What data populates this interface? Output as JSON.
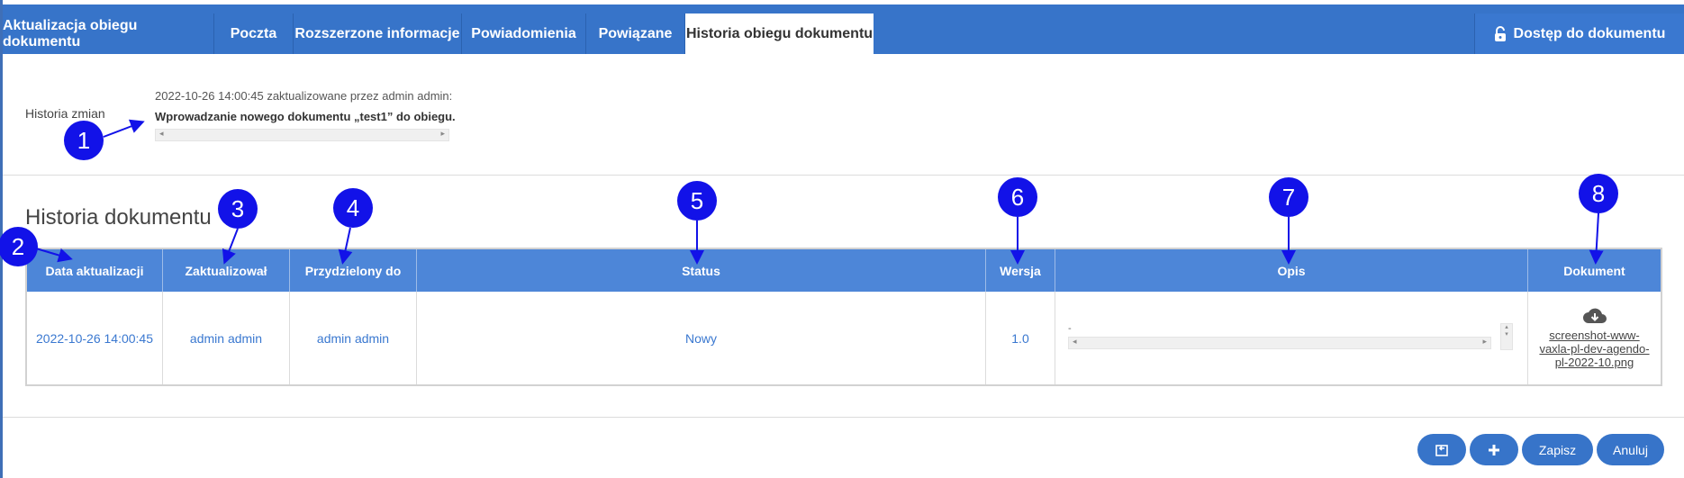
{
  "tabs": [
    {
      "label": "Aktualizacja obiegu dokumentu"
    },
    {
      "label": "Poczta"
    },
    {
      "label": "Rozszerzone informacje"
    },
    {
      "label": "Powiadomienia"
    },
    {
      "label": "Powiązane"
    },
    {
      "label": "Historia obiegu dokumentu"
    }
  ],
  "access_button": {
    "label": "Dostęp do dokumentu",
    "icon": "unlock-icon"
  },
  "history": {
    "label": "Historia zmian",
    "meta": "2022-10-26 14:00:45 zaktualizowane przez admin admin:",
    "text": "Wprowadzanie nowego dokumentu „test1” do obiegu."
  },
  "section_title": "Historia dokumentu",
  "table": {
    "headers": [
      "Data aktualizacji",
      "Zaktualizował",
      "Przydzielony do",
      "Status",
      "Wersja",
      "Opis",
      "Dokument"
    ],
    "rows": [
      {
        "date": "2022-10-26 14:00:45",
        "updated_by": "admin admin",
        "assigned_to": "admin admin",
        "status": "Nowy",
        "version": "1.0",
        "description": "-",
        "document": "screenshot-www-vaxla-pl-dev-agendo-pl-2022-10.png",
        "document_lines": [
          "screenshot-www-",
          "vaxla-pl-dev-agendo-",
          "pl-2022-10.png"
        ]
      }
    ]
  },
  "markers": [
    "1",
    "2",
    "3",
    "4",
    "5",
    "6",
    "7",
    "8"
  ],
  "buttons": {
    "back_icon": "return-icon",
    "add_icon": "plus-icon",
    "save": "Zapisz",
    "cancel": "Anuluj"
  },
  "colors": {
    "accent": "#3774c9",
    "header": "#4d86d8",
    "link": "#3a78d0",
    "marker": "#1212e8"
  }
}
